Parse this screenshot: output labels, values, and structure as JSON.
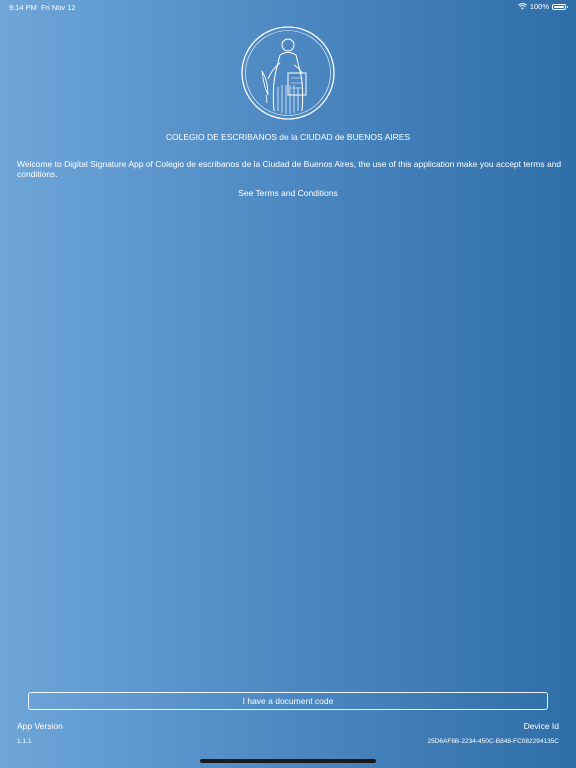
{
  "status_bar": {
    "time": "9:14 PM",
    "date": "Fri Nov 12",
    "battery": "100%",
    "icons": [
      "wifi-icon",
      "battery-icon"
    ]
  },
  "header": {
    "logo_icon": "seal-logo",
    "org_name": "COLEGIO DE ESCRIBANOS de la CIUDAD de BUENOS AIRES"
  },
  "main": {
    "welcome_text": "Welcome to Digital Signature App of  Colegio de escribanos de la Ciudad de Buenos Aires, the use of this application make you accept terms and conditions.",
    "terms_link": "See Terms and Conditions"
  },
  "footer": {
    "document_button": "I have a document code",
    "app_version_label": "App Version",
    "app_version": "1.1.1",
    "device_id_label": "Device Id",
    "device_id": "25D6AF6B-2234-450C-B848-FC082294135C"
  },
  "colors": {
    "gradient_start": "#6ea6d9",
    "gradient_end": "#2f6ea8",
    "text": "#ffffff",
    "home_indicator": "#1a1a1a"
  }
}
